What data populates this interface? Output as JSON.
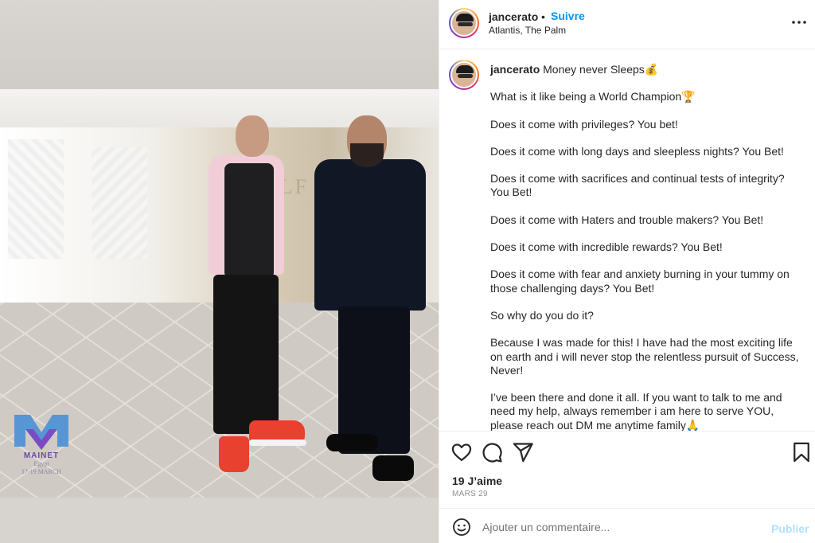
{
  "header": {
    "username": "jancerato",
    "separator": "•",
    "follow_label": "Suivre",
    "location": "Atlantis, The Palm",
    "more_icon": "more-horizontal-icon"
  },
  "media": {
    "sign_text": "OLF",
    "watermark": {
      "name": "MAINET",
      "line1": "Egypt",
      "line2": "17-19 MARCH"
    }
  },
  "caption": {
    "username": "jancerato",
    "lines": [
      "Money never Sleeps💰",
      "What is it like being a World Champion🏆",
      "Does it come with privileges? You bet!",
      "Does it come with long days and sleepless nights? You Bet!",
      "Does it come with sacrifices and continual tests of integrity? You Bet!",
      "Does it come with Haters and trouble makers? You Bet!",
      "Does it come with incredible rewards? You Bet!",
      "Does it come with fear and anxiety burning in your tummy on those challenging days? You Bet!",
      "So why do you do it?",
      "Because I was made for this! I have had the most exciting life on earth and i will never stop the relentless pursuit of Success, Never!",
      "I’ve been there and done it all. If you want to talk to me and need my help, always remember i am here to serve YOU, please reach out DM me anytime family🙏"
    ]
  },
  "actions": {
    "icons": [
      "heart-icon",
      "comment-icon",
      "share-icon",
      "bookmark-icon"
    ],
    "likes": "19 J’aime",
    "date": "MARS 29"
  },
  "comment": {
    "placeholder": "Ajouter un commentaire...",
    "post_label": "Publier",
    "post_color": "#b2dffc",
    "accent": "#0095f6"
  }
}
